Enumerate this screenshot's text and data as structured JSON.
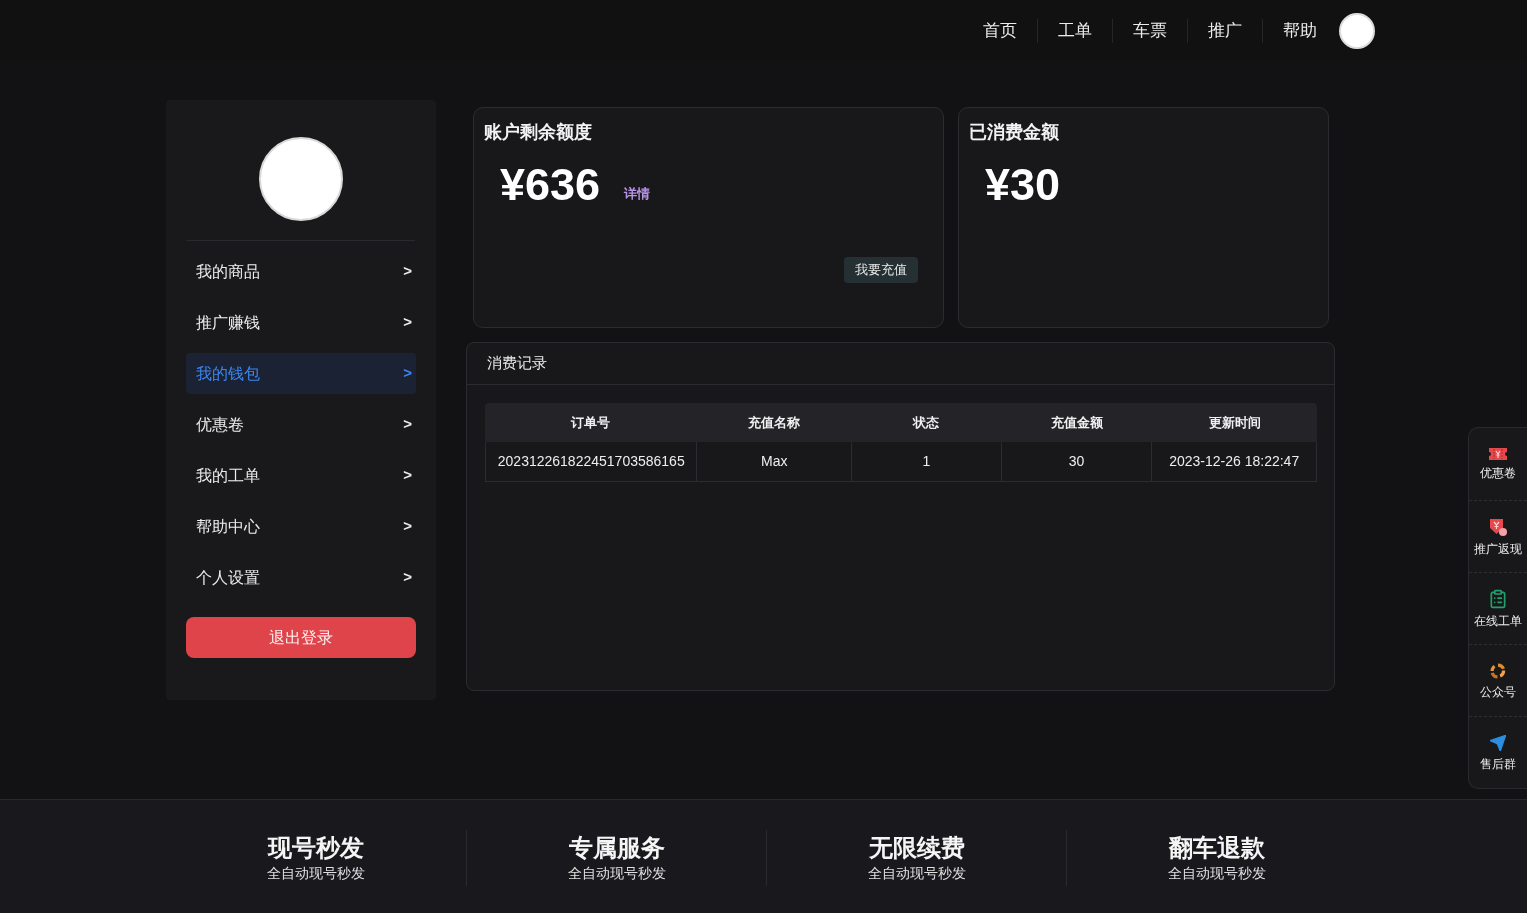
{
  "header": {
    "nav": [
      "首页",
      "工单",
      "车票",
      "推广",
      "帮助"
    ]
  },
  "sidebar": {
    "menu": [
      {
        "label": "我的商品",
        "arrow": ">",
        "selected": false
      },
      {
        "label": "推广赚钱",
        "arrow": ">",
        "selected": false
      },
      {
        "label": "我的钱包",
        "arrow": ">",
        "selected": true
      },
      {
        "label": "优惠卷",
        "arrow": ">",
        "selected": false
      },
      {
        "label": "我的工单",
        "arrow": ">",
        "selected": false
      },
      {
        "label": "帮助中心",
        "arrow": ">",
        "selected": false
      },
      {
        "label": "个人设置",
        "arrow": ">",
        "selected": false
      }
    ],
    "logout_button": "退出登录"
  },
  "balance_card": {
    "title": "账户剩余额度",
    "amount": "¥636",
    "detail_link": "详情",
    "recharge_button": "我要充值"
  },
  "spent_card": {
    "title": "已消费金额",
    "amount": "¥30"
  },
  "records": {
    "title": "消费记录",
    "table": {
      "columns": [
        "订单号",
        "充值名称",
        "状态",
        "充值金额",
        "更新时间"
      ],
      "rows": [
        [
          "202312261822451703586165",
          "Max",
          "1",
          "30",
          "2023-12-26 18:22:47"
        ]
      ]
    }
  },
  "features": [
    {
      "title": "现号秒发",
      "subtitle": "全自动现号秒发"
    },
    {
      "title": "专属服务",
      "subtitle": "全自动现号秒发"
    },
    {
      "title": "无限续费",
      "subtitle": "全自动现号秒发"
    },
    {
      "title": "翻车退款",
      "subtitle": "全自动现号秒发"
    }
  ],
  "float_bar": [
    {
      "kind": "coupon",
      "label": "优惠卷"
    },
    {
      "kind": "rebate",
      "label": "推广返现"
    },
    {
      "kind": "ticket",
      "label": "在线工单"
    },
    {
      "kind": "official",
      "label": "公众号"
    },
    {
      "kind": "support",
      "label": "售后群"
    }
  ]
}
